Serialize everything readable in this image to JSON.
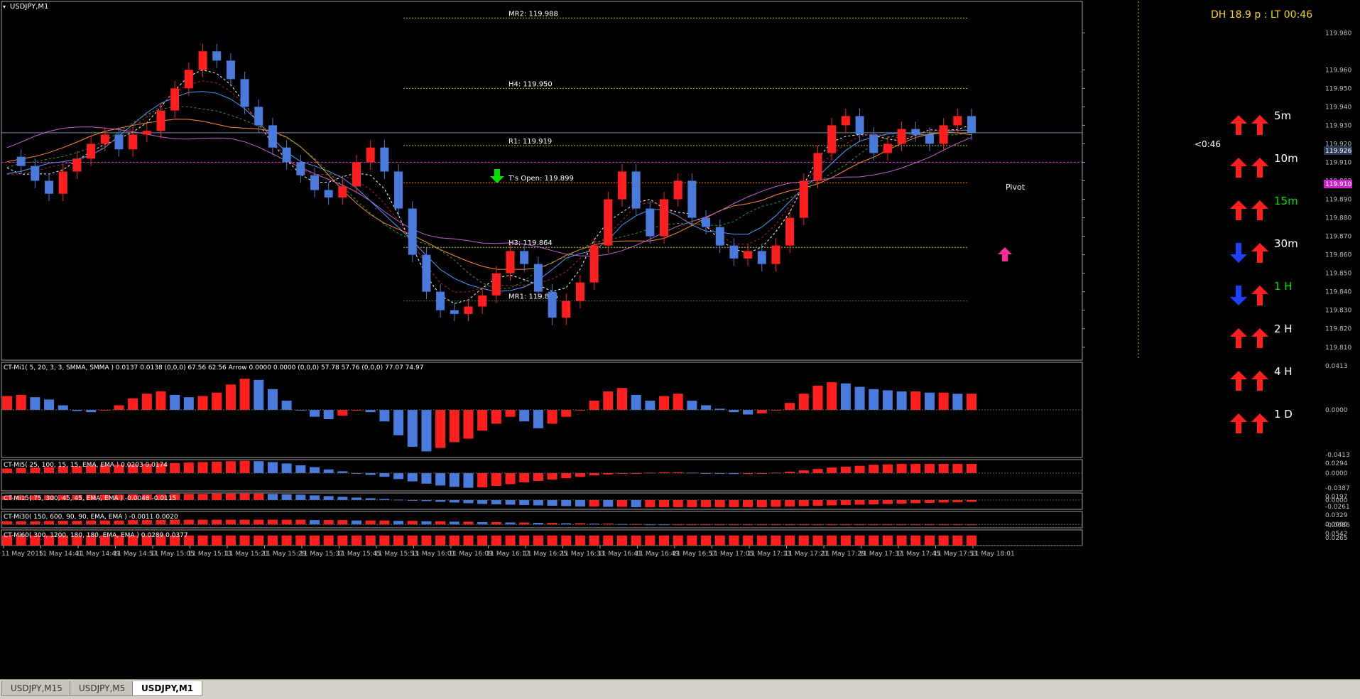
{
  "window": {
    "symbol_title": "USDJPY,M1",
    "corner_info": "DH 18.9 p : LT 00:46"
  },
  "colors": {
    "bull": "#ff1f1f",
    "bear": "#4a7bdc",
    "background": "#000000",
    "axis_text": "#c0c0c0",
    "accent_up": "#ff1f1f",
    "accent_down": "#1f3fff",
    "label_yellow": "#ffd700"
  },
  "levels": [
    {
      "label": "MR2: 119.988",
      "price": 119.988,
      "color": "#c8c800"
    },
    {
      "label": "H4: 119.950",
      "price": 119.95,
      "color": "#c8c800"
    },
    {
      "label": "R1: 119.919",
      "price": 119.919,
      "color": "#c8c800"
    },
    {
      "label": "T's Open: 119.899",
      "price": 119.899,
      "color": "#ff6a00"
    },
    {
      "label": "H3: 119.864",
      "price": 119.864,
      "color": "#c8c800"
    },
    {
      "label": "MR1: 119.835",
      "price": 119.835,
      "color": "#2e8b2e"
    }
  ],
  "pivot_label": "Pivot",
  "price_marker": {
    "countdown": "<0:46",
    "current": "119.926",
    "magenta": "119.910"
  },
  "timeframes": [
    {
      "label": "5m",
      "arrow1": "up",
      "arrow2": "up",
      "color": "#ffffff"
    },
    {
      "label": "10m",
      "arrow1": "up",
      "arrow2": "up",
      "color": "#ffffff"
    },
    {
      "label": "15m",
      "arrow1": "up",
      "arrow2": "up",
      "color": "#00e000"
    },
    {
      "label": "30m",
      "arrow1": "down",
      "arrow2": "up",
      "color": "#ffffff"
    },
    {
      "label": "1 H",
      "arrow1": "down",
      "arrow2": "up",
      "color": "#00e000"
    },
    {
      "label": "2 H",
      "arrow1": "up",
      "arrow2": "up",
      "color": "#ffffff"
    },
    {
      "label": "4 H",
      "arrow1": "up",
      "arrow2": "up",
      "color": "#ffffff"
    },
    {
      "label": "1 D",
      "arrow1": "up",
      "arrow2": "up",
      "color": "#ffffff"
    }
  ],
  "chart_data": [
    {
      "type": "candlestick",
      "title": "USDJPY,M1",
      "y_ticks": [
        "119.980",
        "119.960",
        "119.950",
        "119.940",
        "119.930",
        "119.920",
        "119.910",
        "119.900",
        "119.890",
        "119.880",
        "119.870",
        "119.860",
        "119.850",
        "119.840",
        "119.830",
        "119.820",
        "119.810"
      ],
      "ylim": [
        119.803,
        119.997
      ],
      "x_ticks": [
        "11 May 2015",
        "11 May 14:41",
        "11 May 14:49",
        "11 May 14:57",
        "11 May 15:05",
        "11 May 15:13",
        "11 May 15:21",
        "11 May 15:29",
        "11 May 15:37",
        "11 May 15:45",
        "11 May 15:53",
        "11 May 16:01",
        "11 May 16:09",
        "11 May 16:17",
        "11 May 16:25",
        "11 May 16:33",
        "11 May 16:41",
        "11 May 16:49",
        "11 May 16:57",
        "11 May 17:05",
        "11 May 17:13",
        "11 May 17:21",
        "11 May 17:29",
        "11 May 17:37",
        "11 May 17:45",
        "11 May 17:53",
        "11 May 18:01"
      ],
      "close_path": [
        119.913,
        119.908,
        119.9,
        119.893,
        119.905,
        119.912,
        119.92,
        119.925,
        119.917,
        119.925,
        119.927,
        119.938,
        119.95,
        119.96,
        119.97,
        119.965,
        119.955,
        119.94,
        119.93,
        119.918,
        119.91,
        119.903,
        119.895,
        119.891,
        119.897,
        119.91,
        119.918,
        119.905,
        119.885,
        119.86,
        119.84,
        119.83,
        119.828,
        119.832,
        119.838,
        119.85,
        119.862,
        119.855,
        119.84,
        119.826,
        119.835,
        119.845,
        119.865,
        119.89,
        119.905,
        119.885,
        119.87,
        119.89,
        119.9,
        119.88,
        119.875,
        119.865,
        119.858,
        119.862,
        119.855,
        119.865,
        119.88,
        119.9,
        119.915,
        119.93,
        119.935,
        119.925,
        119.915,
        119.92,
        119.928,
        119.925,
        119.92,
        119.93,
        119.935,
        119.926
      ]
    },
    {
      "type": "bar",
      "title": "CT-Mi1( 5, 20, 3, 3, SMMA, SMMA ) 0.0137 0.0138 (0,0,0) 67.56 62.56 Arrow 0.0000 0.0000 (0,0,0) 57.78 57.76 (0,0,0) 77.07 74.97",
      "y_ticks": [
        "0.0413",
        "0.0000",
        "-0.0413"
      ],
      "ylim": [
        -0.0413,
        0.0413
      ],
      "values": [
        0.012,
        0.013,
        0.011,
        0.009,
        0.004,
        -0.001,
        -0.002,
        0.0,
        0.004,
        0.01,
        0.014,
        0.016,
        0.013,
        0.011,
        0.012,
        0.015,
        0.022,
        0.027,
        0.026,
        0.018,
        0.008,
        0.0,
        -0.006,
        -0.008,
        -0.005,
        0.0,
        -0.002,
        -0.01,
        -0.022,
        -0.032,
        -0.036,
        -0.033,
        -0.028,
        -0.025,
        -0.018,
        -0.012,
        -0.006,
        -0.01,
        -0.016,
        -0.012,
        -0.006,
        0.0,
        0.008,
        0.016,
        0.019,
        0.013,
        0.008,
        0.012,
        0.014,
        0.008,
        0.004,
        0.001,
        -0.002,
        -0.004,
        -0.003,
        0.0,
        0.006,
        0.014,
        0.021,
        0.024,
        0.023,
        0.02,
        0.018,
        0.017,
        0.016,
        0.016,
        0.015,
        0.015,
        0.014,
        0.014
      ]
    },
    {
      "type": "bar",
      "title": "CT-Mi5( 25, 100, 15, 15, EMA, EMA ) 0.0203 0.0174",
      "y_ticks": [
        "0.0294",
        "0.0000",
        "-0.0387"
      ],
      "ylim": [
        -0.0387,
        0.0294
      ],
      "values": [
        0.01,
        0.011,
        0.012,
        0.013,
        0.014,
        0.015,
        0.016,
        0.017,
        0.018,
        0.019,
        0.02,
        0.021,
        0.022,
        0.023,
        0.024,
        0.025,
        0.026,
        0.027,
        0.026,
        0.024,
        0.021,
        0.017,
        0.013,
        0.008,
        0.004,
        0.0,
        -0.004,
        -0.008,
        -0.013,
        -0.018,
        -0.023,
        -0.027,
        -0.03,
        -0.032,
        -0.031,
        -0.028,
        -0.024,
        -0.02,
        -0.017,
        -0.014,
        -0.011,
        -0.008,
        -0.005,
        -0.003,
        -0.001,
        0.0,
        0.001,
        0.002,
        0.002,
        0.001,
        0.0,
        -0.001,
        -0.002,
        -0.002,
        -0.001,
        0.001,
        0.003,
        0.006,
        0.009,
        0.012,
        0.014,
        0.016,
        0.018,
        0.019,
        0.02,
        0.02,
        0.02,
        0.02,
        0.02,
        0.02
      ]
    },
    {
      "type": "bar",
      "title": "CT-Mi15( 75, 300, 45, 45, EMA, EMA ) -0.0048 -0.0115",
      "y_ticks": [
        "0.0197",
        "0.0000",
        "-0.0261"
      ],
      "ylim": [
        -0.0261,
        0.0197
      ],
      "values": [
        0.012,
        0.012,
        0.013,
        0.013,
        0.014,
        0.014,
        0.015,
        0.015,
        0.015,
        0.016,
        0.016,
        0.016,
        0.017,
        0.017,
        0.017,
        0.018,
        0.018,
        0.018,
        0.018,
        0.017,
        0.016,
        0.015,
        0.013,
        0.011,
        0.009,
        0.007,
        0.005,
        0.003,
        0.001,
        -0.001,
        -0.003,
        -0.005,
        -0.007,
        -0.009,
        -0.011,
        -0.012,
        -0.013,
        -0.014,
        -0.015,
        -0.016,
        -0.017,
        -0.018,
        -0.018,
        -0.019,
        -0.019,
        -0.02,
        -0.02,
        -0.02,
        -0.02,
        -0.02,
        -0.02,
        -0.02,
        -0.02,
        -0.02,
        -0.02,
        -0.019,
        -0.018,
        -0.017,
        -0.016,
        -0.015,
        -0.014,
        -0.013,
        -0.012,
        -0.011,
        -0.01,
        -0.009,
        -0.008,
        -0.007,
        -0.006,
        -0.005
      ]
    },
    {
      "type": "bar",
      "title": "CT-Mi30( 150, 600, 90, 90, EMA, EMA ) -0.0011 0.0020",
      "y_ticks": [
        "0.0329",
        "0.0000",
        "-0.0086"
      ],
      "ylim": [
        -0.0086,
        0.0329
      ],
      "values": [
        0.008,
        0.008,
        0.008,
        0.009,
        0.009,
        0.009,
        0.01,
        0.01,
        0.01,
        0.011,
        0.011,
        0.011,
        0.012,
        0.012,
        0.012,
        0.012,
        0.012,
        0.012,
        0.012,
        0.012,
        0.012,
        0.012,
        0.011,
        0.011,
        0.011,
        0.01,
        0.01,
        0.01,
        0.009,
        0.009,
        0.008,
        0.008,
        0.007,
        0.007,
        0.006,
        0.006,
        0.005,
        0.005,
        0.004,
        0.004,
        0.003,
        0.003,
        0.002,
        0.002,
        0.001,
        0.001,
        0.0,
        -0.001,
        -0.001,
        -0.001,
        -0.001,
        -0.001,
        -0.001,
        -0.001,
        -0.001,
        -0.001,
        -0.001,
        -0.001,
        -0.001,
        -0.001,
        -0.001,
        -0.001,
        -0.001,
        -0.001,
        -0.001,
        -0.001,
        -0.001,
        -0.001,
        -0.001,
        -0.001
      ]
    },
    {
      "type": "bar",
      "title": "CT-Mi60( 300, 1200, 180, 180, EMA, EMA ) 0.0289 0.0377",
      "y_ticks": [
        "0.0542",
        "0.0265"
      ],
      "ylim": [
        0.0,
        0.0542
      ],
      "values": [
        0.035,
        0.035,
        0.035,
        0.035,
        0.035,
        0.035,
        0.035,
        0.035,
        0.035,
        0.035,
        0.035,
        0.035,
        0.035,
        0.035,
        0.035,
        0.035,
        0.035,
        0.035,
        0.035,
        0.035,
        0.035,
        0.035,
        0.035,
        0.035,
        0.035,
        0.035,
        0.035,
        0.035,
        0.035,
        0.035,
        0.035,
        0.035,
        0.035,
        0.035,
        0.035,
        0.035,
        0.035,
        0.035,
        0.035,
        0.035,
        0.035,
        0.035,
        0.035,
        0.035,
        0.035,
        0.035,
        0.035,
        0.035,
        0.035,
        0.035,
        0.035,
        0.035,
        0.035,
        0.035,
        0.035,
        0.035,
        0.035,
        0.035,
        0.035,
        0.035,
        0.035,
        0.035,
        0.035,
        0.035,
        0.035,
        0.035,
        0.035,
        0.035,
        0.035,
        0.035
      ]
    }
  ],
  "tabs": [
    {
      "label": "USDJPY,M15"
    },
    {
      "label": "USDJPY,M5"
    },
    {
      "label": "USDJPY,M1"
    }
  ]
}
